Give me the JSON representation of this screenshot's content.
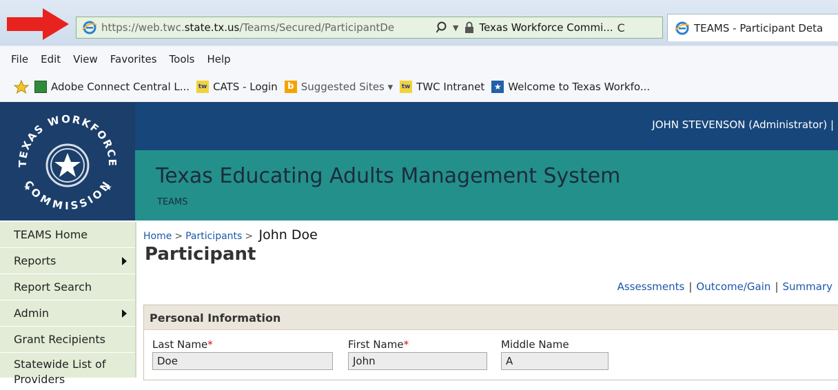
{
  "browser": {
    "address": {
      "url_prefix": "https://web.twc.",
      "url_domain": "state.tx.us",
      "url_path": "/Teams/Secured/ParticipantDe",
      "certificate_label": "Texas Workforce Commi...",
      "refresh_glyph": "C"
    },
    "tab_title": "TEAMS - Participant Deta",
    "menu": [
      "File",
      "Edit",
      "View",
      "Favorites",
      "Tools",
      "Help"
    ],
    "favorites": [
      {
        "label": "Adobe Connect Central L..."
      },
      {
        "label": "CATS - Login"
      },
      {
        "label": "Suggested Sites ▾"
      },
      {
        "label": "TWC Intranet"
      },
      {
        "label": "Welcome to Texas Workfo..."
      }
    ]
  },
  "header": {
    "user": "JOHN STEVENSON (Administrator) |",
    "system_title": "Texas Educating Adults Management System",
    "system_subtitle": "TEAMS",
    "logo_text_top": "TEXAS WORKFORCE",
    "logo_text_bottom": "COMMISSION"
  },
  "sidebar": {
    "items": [
      {
        "label": "TEAMS Home"
      },
      {
        "label": "Reports"
      },
      {
        "label": "Report Search"
      },
      {
        "label": "Admin"
      },
      {
        "label": "Grant Recipients"
      },
      {
        "label": "Statewide List of Providers"
      }
    ]
  },
  "breadcrumb": {
    "home": "Home",
    "participants": "Participants",
    "separator": ">",
    "current": "John Doe"
  },
  "page": {
    "title": "Participant",
    "links": [
      "Assessments",
      "Outcome/Gain",
      "Summary"
    ],
    "link_separator": "|"
  },
  "personal_info": {
    "heading": "Personal Information",
    "required_marker": "*",
    "last_name": {
      "label": "Last Name",
      "value": "Doe"
    },
    "first_name": {
      "label": "First Name",
      "value": "John"
    },
    "middle_name": {
      "label": "Middle Name",
      "value": "A"
    }
  },
  "colors": {
    "arrow": "#e8231f",
    "header_dark": "#17467a",
    "header_teal": "#23908c",
    "sidebar_bg": "#e3ecd6",
    "link": "#1b56a8"
  }
}
